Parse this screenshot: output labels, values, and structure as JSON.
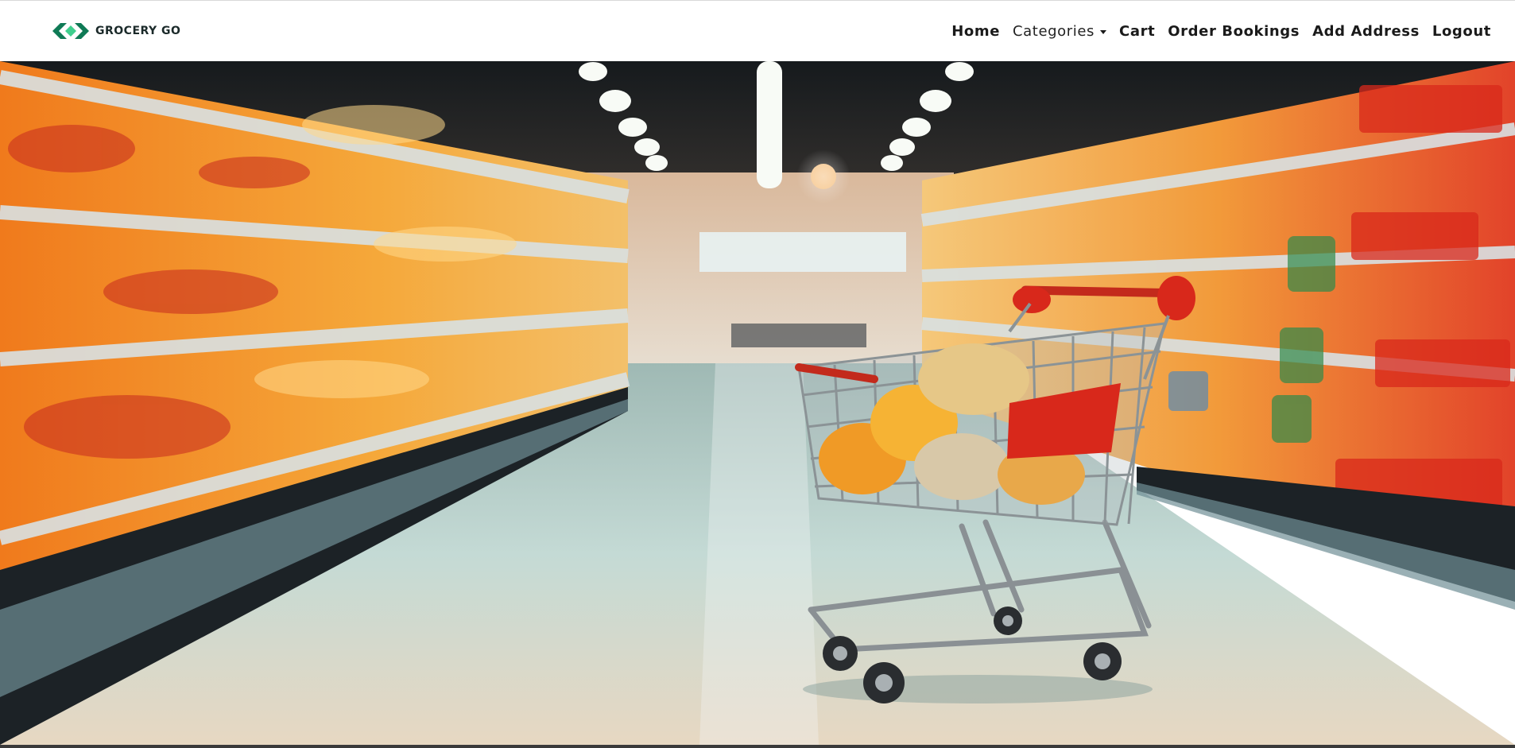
{
  "brand": {
    "name": "GROCERY GO",
    "logo_icon": "diamond-arrows-logo-icon",
    "colors": {
      "primary": "#0f7a55",
      "secondary": "#3fcf8e"
    }
  },
  "nav": {
    "home": "Home",
    "categories": "Categories",
    "cart": "Cart",
    "order_bookings": "Order Bookings",
    "add_address": "Add Address",
    "logout": "Logout"
  },
  "hero": {
    "image_subject": "supermarket-aisle-with-shopping-cart",
    "colors": {
      "produce": "#f28a1f",
      "cart_handle": "#d8281b",
      "floor": "#b8d2cc"
    }
  }
}
